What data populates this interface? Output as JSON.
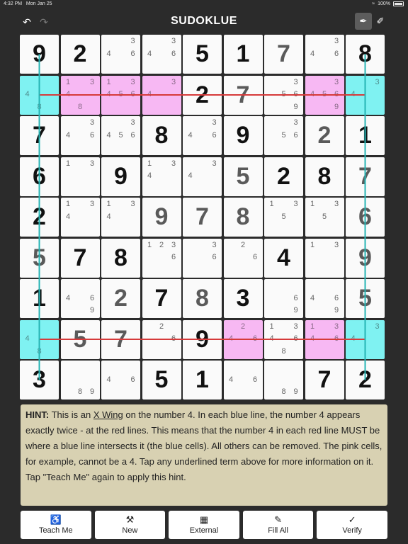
{
  "status_bar": {
    "time": "4:32 PM",
    "date": "Mon Jan 25",
    "wifi_icon": "wifi-icon",
    "battery": "100%"
  },
  "header": {
    "title": "SUDOKLUE",
    "undo_icon": "undo-icon",
    "redo_icon": "redo-icon",
    "pencil_mode_icon": "pencil-icon",
    "pen_mode_icon": "pen-icon"
  },
  "colors": {
    "background": "#2b2b2b",
    "cell": "#fafafa",
    "highlight_cyan": "#7ff2f2",
    "highlight_pink": "#f7b8f3",
    "line_red": "#d63a3a",
    "line_blue": "#25b4b4",
    "hint_bg": "#d8d1b2"
  },
  "grid": {
    "values": [
      [
        9,
        2,
        0,
        0,
        5,
        1,
        7,
        0,
        8
      ],
      [
        0,
        0,
        0,
        0,
        2,
        7,
        0,
        0,
        0
      ],
      [
        7,
        0,
        0,
        8,
        0,
        9,
        0,
        2,
        1
      ],
      [
        6,
        0,
        9,
        0,
        0,
        5,
        2,
        8,
        7
      ],
      [
        2,
        0,
        0,
        9,
        7,
        8,
        0,
        0,
        6
      ],
      [
        5,
        7,
        8,
        0,
        0,
        0,
        4,
        0,
        9
      ],
      [
        1,
        0,
        2,
        7,
        8,
        3,
        0,
        0,
        5
      ],
      [
        0,
        5,
        7,
        0,
        9,
        0,
        0,
        0,
        0
      ],
      [
        3,
        0,
        0,
        5,
        1,
        0,
        0,
        7,
        2
      ]
    ],
    "given": [
      [
        1,
        1,
        0,
        0,
        1,
        1,
        0,
        0,
        1
      ],
      [
        0,
        0,
        0,
        0,
        1,
        0,
        0,
        0,
        0
      ],
      [
        1,
        0,
        0,
        1,
        0,
        1,
        0,
        0,
        1
      ],
      [
        1,
        0,
        1,
        0,
        0,
        0,
        1,
        1,
        0
      ],
      [
        1,
        0,
        0,
        0,
        0,
        0,
        0,
        0,
        0
      ],
      [
        0,
        1,
        1,
        0,
        0,
        0,
        1,
        0,
        0
      ],
      [
        1,
        0,
        0,
        1,
        0,
        1,
        0,
        0,
        0
      ],
      [
        0,
        0,
        0,
        0,
        1,
        0,
        0,
        0,
        0
      ],
      [
        1,
        0,
        0,
        1,
        1,
        0,
        0,
        1,
        1
      ]
    ],
    "candidates": [
      [
        [],
        [],
        [
          3,
          4,
          6
        ],
        [
          3,
          4,
          6
        ],
        [],
        [],
        [],
        [
          3,
          4,
          6
        ],
        []
      ],
      [
        [
          4,
          8
        ],
        [
          1,
          3,
          4,
          8
        ],
        [
          1,
          3,
          4,
          5,
          6
        ],
        [
          3,
          4
        ],
        [],
        [],
        [
          3,
          5,
          6,
          9
        ],
        [
          3,
          4,
          5,
          6,
          9
        ],
        [
          3,
          4
        ]
      ],
      [
        [],
        [
          3,
          4,
          6
        ],
        [
          3,
          4,
          5,
          6
        ],
        [],
        [
          3,
          4,
          6
        ],
        [],
        [
          3,
          5,
          6
        ],
        [],
        []
      ],
      [
        [],
        [
          1,
          3
        ],
        [],
        [
          1,
          3,
          4
        ],
        [
          3,
          4
        ],
        [],
        [],
        [],
        []
      ],
      [
        [],
        [
          1,
          3,
          4
        ],
        [
          1,
          3,
          4
        ],
        [],
        [],
        [],
        [
          1,
          3,
          5
        ],
        [
          1,
          3,
          5
        ],
        []
      ],
      [
        [],
        [],
        [],
        [
          1,
          2,
          3,
          6
        ],
        [
          3,
          6
        ],
        [
          2,
          6
        ],
        [],
        [
          1,
          3
        ],
        []
      ],
      [
        [],
        [
          4,
          6,
          9
        ],
        [],
        [],
        [],
        [],
        [
          6,
          9
        ],
        [
          4,
          6,
          9
        ],
        []
      ],
      [
        [
          4,
          8
        ],
        [],
        [],
        [
          2,
          6
        ],
        [],
        [
          2,
          4,
          6
        ],
        [
          1,
          3,
          4,
          6,
          8
        ],
        [
          1,
          3,
          4,
          6
        ],
        [
          3,
          4
        ]
      ],
      [
        [],
        [
          8,
          9
        ],
        [
          4,
          6
        ],
        [],
        [],
        [
          4,
          6
        ],
        [
          8,
          9
        ],
        [],
        []
      ]
    ],
    "highlights": [
      {
        "row": 1,
        "col": 0,
        "color": "cyan"
      },
      {
        "row": 1,
        "col": 8,
        "color": "cyan"
      },
      {
        "row": 7,
        "col": 0,
        "color": "cyan"
      },
      {
        "row": 7,
        "col": 8,
        "color": "cyan"
      },
      {
        "row": 1,
        "col": 1,
        "color": "pink"
      },
      {
        "row": 1,
        "col": 2,
        "color": "pink"
      },
      {
        "row": 1,
        "col": 3,
        "color": "pink"
      },
      {
        "row": 1,
        "col": 7,
        "color": "pink"
      },
      {
        "row": 7,
        "col": 5,
        "color": "pink"
      },
      {
        "row": 7,
        "col": 7,
        "color": "pink"
      }
    ],
    "red_lines_rows": [
      1,
      7
    ],
    "blue_lines_cols": [
      0,
      8
    ]
  },
  "hint": {
    "label": "HINT:",
    "t1": " This is an ",
    "link": "X Wing",
    "t2": " on the number 4. In each blue line, the number 4 appears exactly twice - at the red lines. This means that the number 4 in each red line MUST be where a blue line intersects it (the blue cells). All others can be removed. The pink cells, for example, cannot be a 4. Tap any underlined term above for more information on it. Tap \"Teach Me\" again to apply this hint."
  },
  "toolbar": {
    "buttons": [
      {
        "label": "Teach Me",
        "icon": "♿",
        "icon_name": "teach-icon"
      },
      {
        "label": "New",
        "icon": "⚒",
        "icon_name": "wrench-icon"
      },
      {
        "label": "External",
        "icon": "▦",
        "icon_name": "grid-icon"
      },
      {
        "label": "Fill All",
        "icon": "✎",
        "icon_name": "pencil-icon"
      },
      {
        "label": "Verify",
        "icon": "✓",
        "icon_name": "check-icon"
      }
    ]
  }
}
